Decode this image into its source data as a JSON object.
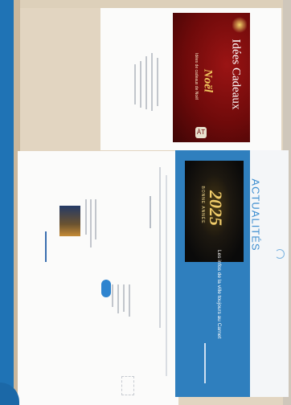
{
  "gift_card": {
    "title": "Idées Cadeaux",
    "subtitle": "Noël",
    "tagline": "Idées de cadeaux de Noël",
    "logo": "ÀT"
  },
  "new_year_card": {
    "heading": "BONNE ANNÉE",
    "year": "2025"
  },
  "news": {
    "section_label": "ACTUALITÉS",
    "text": "Les infos de la ville toujours au Carnet"
  },
  "colors": {
    "accent_blue": "#2f7fbe",
    "gift_red": "#6e0a0a",
    "gold": "#f0cc6a"
  }
}
